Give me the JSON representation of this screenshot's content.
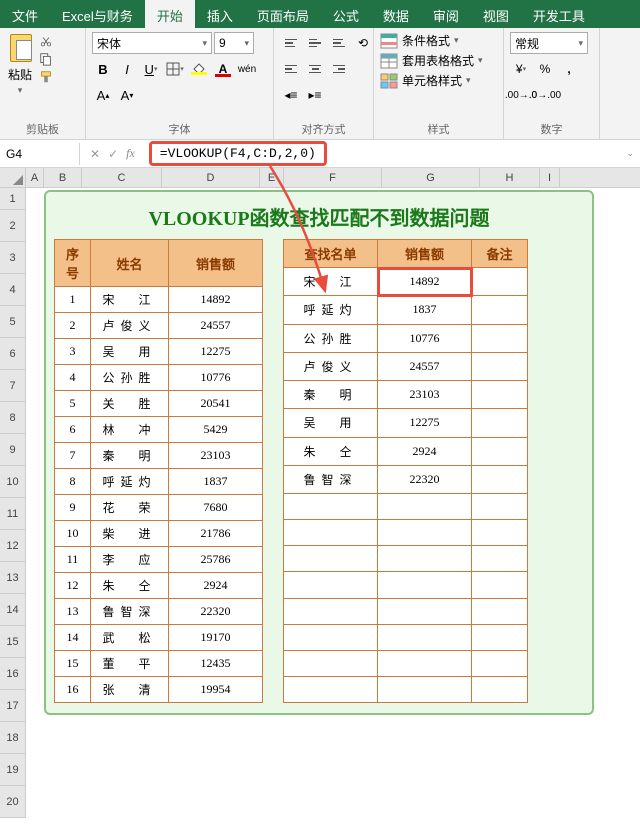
{
  "tabs": [
    "文件",
    "Excel与财务",
    "开始",
    "插入",
    "页面布局",
    "公式",
    "数据",
    "审阅",
    "视图",
    "开发工具"
  ],
  "active_tab": 2,
  "ribbon": {
    "clipboard": {
      "label": "剪贴板",
      "paste": "粘贴"
    },
    "font": {
      "label": "字体",
      "name": "宋体",
      "size": "9"
    },
    "align": {
      "label": "对齐方式"
    },
    "styles": {
      "label": "样式",
      "cond": "条件格式",
      "table": "套用表格格式",
      "cell": "单元格样式"
    },
    "number": {
      "label": "数字",
      "format": "常规"
    }
  },
  "namebox": "G4",
  "formula": "=VLOOKUP(F4,C:D,2,0)",
  "cols": [
    "A",
    "B",
    "C",
    "D",
    "E",
    "F",
    "G",
    "H",
    "I"
  ],
  "row_nums": [
    1,
    2,
    3,
    4,
    5,
    6,
    7,
    8,
    9,
    10,
    11,
    12,
    13,
    14,
    15,
    16,
    17,
    18,
    19,
    20
  ],
  "title": "VLOOKUP函数查找匹配不到数据问题",
  "left": {
    "headers": [
      "序号",
      "姓名",
      "销售额"
    ],
    "rows": [
      [
        "1",
        "宋　江",
        "14892"
      ],
      [
        "2",
        "卢俊义",
        "24557"
      ],
      [
        "3",
        "吴　用",
        "12275"
      ],
      [
        "4",
        "公孙胜",
        "10776"
      ],
      [
        "5",
        "关　胜",
        "20541"
      ],
      [
        "6",
        "林　冲",
        "5429"
      ],
      [
        "7",
        "秦　明",
        "23103"
      ],
      [
        "8",
        "呼延灼",
        "1837"
      ],
      [
        "9",
        "花　荣",
        "7680"
      ],
      [
        "10",
        "柴　进",
        "21786"
      ],
      [
        "11",
        "李　应",
        "25786"
      ],
      [
        "12",
        "朱　仝",
        "2924"
      ],
      [
        "13",
        "鲁智深",
        "22320"
      ],
      [
        "14",
        "武　松",
        "19170"
      ],
      [
        "15",
        "董　平",
        "12435"
      ],
      [
        "16",
        "张　清",
        "19954"
      ]
    ]
  },
  "right": {
    "headers": [
      "查找名单",
      "销售额",
      "备注"
    ],
    "rows": [
      [
        "宋　江",
        "14892",
        ""
      ],
      [
        "呼延灼",
        "1837",
        ""
      ],
      [
        "公孙胜",
        "10776",
        ""
      ],
      [
        "卢俊义",
        "24557",
        ""
      ],
      [
        "秦　明",
        "23103",
        ""
      ],
      [
        "吴　用",
        "12275",
        ""
      ],
      [
        "朱　仝",
        "2924",
        ""
      ],
      [
        "鲁智深",
        "22320",
        ""
      ],
      [
        "",
        "",
        ""
      ],
      [
        "",
        "",
        ""
      ],
      [
        "",
        "",
        ""
      ],
      [
        "",
        "",
        ""
      ],
      [
        "",
        "",
        ""
      ],
      [
        "",
        "",
        ""
      ],
      [
        "",
        "",
        ""
      ],
      [
        "",
        "",
        ""
      ]
    ]
  },
  "highlight": {
    "row": 0,
    "col": 1
  }
}
